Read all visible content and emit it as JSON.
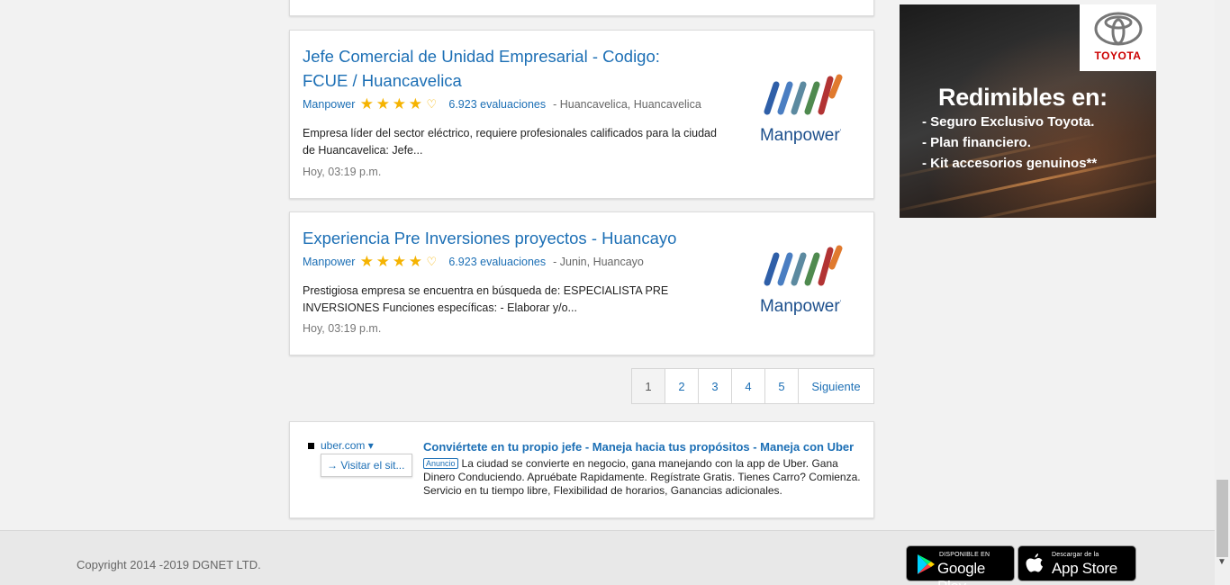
{
  "jobs": [
    {
      "title": "Jefe Comercial de Unidad Empresarial - Codigo: FCUE / Huancavelica",
      "company": "Manpower",
      "rating": 4,
      "reviews": "6.923 evaluaciones",
      "location": "- Huancavelica, Huancavelica",
      "description": "Empresa líder del sector eléctrico, requiere profesionales calificados para la ciudad de Huancavelica: Jefe...",
      "date": "Hoy, 03:19 p.m.",
      "logo_text": "Manpower"
    },
    {
      "title": "Experiencia Pre Inversiones proyectos - Huancayo",
      "company": "Manpower",
      "rating": 4,
      "reviews": "6.923 evaluaciones",
      "location": "- Junin, Huancayo",
      "description": "Prestigiosa empresa se encuentra en búsqueda de: ESPECIALISTA PRE INVERSIONES Funciones específicas: - Elaborar y/o...",
      "date": "Hoy, 03:19 p.m.",
      "logo_text": "Manpower"
    }
  ],
  "pagination": {
    "pages": [
      "1",
      "2",
      "3",
      "4",
      "5"
    ],
    "current": "1",
    "next_label": "Siguiente"
  },
  "ad": {
    "domain": "uber.com ▾",
    "visit_label": "→ Visitar el sit...",
    "title": "Conviértete en tu propio jefe - Maneja hacia tus propósitos - Maneja con Uber",
    "badge": "Anuncio",
    "body": "La ciudad se convierte en negocio, gana manejando con la app de Uber. Gana Dinero Conduciendo. Apruébate Rapidamente. Regístrate Gratis. Tienes Carro? Comienza. Servicio en tu tiempo libre, Flexibilidad de horarios, Ganancias adicionales."
  },
  "banner": {
    "brand": "TOYOTA",
    "heading": "Redimibles en:",
    "lines": [
      "- Seguro Exclusivo Toyota.",
      "- Plan financiero.",
      "- Kit accesorios genuinos**"
    ]
  },
  "footer": {
    "copyright": "Copyright 2014 -2019 DGNET LTD.",
    "google_play_small": "DISPONIBLE EN",
    "google_play_big": "Google Play",
    "app_store_small": "Descargar de la",
    "app_store_big": "App Store"
  },
  "colors": {
    "link": "#1c6fb5",
    "star": "#f5b301",
    "logo_bars": [
      "#2f5fa8",
      "#4a7ec2",
      "#5c8aa0",
      "#4f8a4f",
      "#b23333",
      "#e07a2e"
    ]
  }
}
